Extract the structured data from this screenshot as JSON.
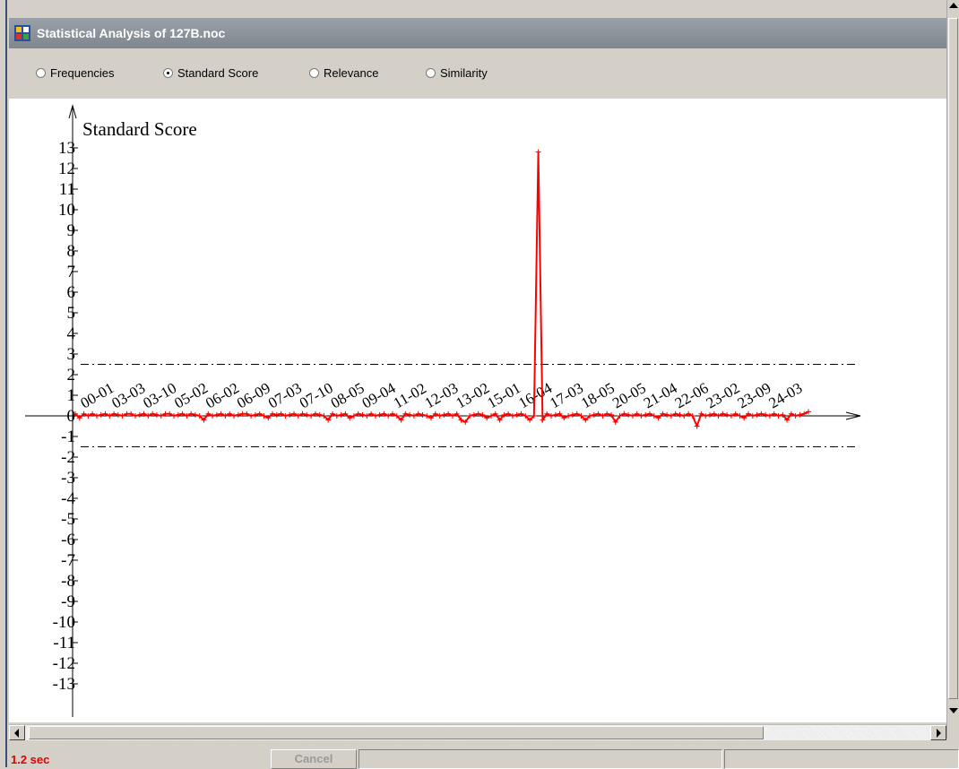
{
  "window": {
    "title": "Statistical Analysis of 127B.noc"
  },
  "colors": {
    "series": "#ff0000",
    "axis": "#000000",
    "threshold": "#000000",
    "titlebar": "#80868e",
    "status_time": "#e00000"
  },
  "toolbar": {
    "options": [
      {
        "label": "Frequencies",
        "selected": false
      },
      {
        "label": "Standard Score",
        "selected": true
      },
      {
        "label": "Relevance",
        "selected": false
      },
      {
        "label": "Similarity",
        "selected": false
      }
    ]
  },
  "status": {
    "elapsed": "1.2 sec",
    "cancel_label": "Cancel"
  },
  "chart_data": {
    "type": "line",
    "ylabel": "Standard Score",
    "ylim": [
      -13,
      13
    ],
    "y_ticks": [
      13,
      12,
      11,
      10,
      9,
      8,
      7,
      6,
      5,
      4,
      3,
      2,
      1,
      0,
      -1,
      -2,
      -3,
      -4,
      -5,
      -6,
      -7,
      -8,
      -9,
      -10,
      -11,
      -12,
      -13
    ],
    "thresholds": [
      2.5,
      -1.5
    ],
    "grid": false,
    "x_labels": [
      "00-01",
      "03-03",
      "03-10",
      "05-02",
      "06-02",
      "06-09",
      "07-03",
      "07-10",
      "08-05",
      "09-04",
      "11-02",
      "12-03",
      "13-02",
      "15-01",
      "16-04",
      "17-03",
      "18-05",
      "20-05",
      "21-04",
      "22-06",
      "23-02",
      "23-09",
      "24-03"
    ],
    "series": [
      {
        "values": [
          0.1,
          -0.1,
          0.1,
          0,
          0.1,
          0,
          0.05,
          0.1,
          0,
          0.1,
          0.05,
          0,
          0.1,
          0.1,
          0,
          0.05,
          0.1,
          0,
          0.1,
          0.05,
          0,
          0.1,
          0.1,
          0,
          0.05,
          0.1,
          0,
          0.1,
          0.05,
          0,
          -0.2,
          0.1,
          0,
          0.05,
          0.1,
          0,
          0.1,
          0,
          0.05,
          0.1,
          0.1,
          0,
          0.05,
          0.1,
          0,
          -0.1,
          0.1,
          0.05,
          0.1,
          0,
          0.05,
          0.1,
          0,
          0.1,
          0.05,
          0,
          0.1,
          0.05,
          0,
          -0.2,
          0.1,
          0,
          0.05,
          0.1,
          -0.1,
          0,
          0.1,
          0.05,
          0,
          0.1,
          0,
          0.05,
          0.1,
          0,
          0.1,
          0,
          -0.2,
          0.1,
          0.05,
          0,
          0.1,
          0.05,
          0,
          -0.1,
          0.1,
          0,
          0.05,
          0.1,
          0,
          0.1,
          -0.2,
          -0.3,
          0,
          0.05,
          0.1,
          0.05,
          -0.1,
          0,
          0.1,
          -0.2,
          0.05,
          0.1,
          0,
          0.05,
          0.1,
          0,
          -0.2,
          0,
          12.8,
          -0.2,
          0.1,
          0,
          0.05,
          0.1,
          -0.1,
          0,
          0.05,
          0.1,
          0,
          -0.2,
          0,
          0.05,
          0.1,
          0,
          0.1,
          0.05,
          -0.3,
          0,
          0.1,
          0.05,
          0,
          0.1,
          0,
          0.05,
          0.1,
          0,
          -0.1,
          0.1,
          0.05,
          0,
          0.1,
          0.05,
          0,
          0.1,
          0,
          -0.5,
          0.1,
          0,
          0.05,
          0.1,
          0,
          0.1,
          0.05,
          0,
          0.1,
          0,
          -0.1,
          0.1,
          0,
          0.05,
          0.1,
          0.05,
          0,
          0.1,
          0,
          0.05,
          -0.2,
          0.1,
          0,
          0.05,
          0.1,
          0.2
        ]
      }
    ]
  }
}
